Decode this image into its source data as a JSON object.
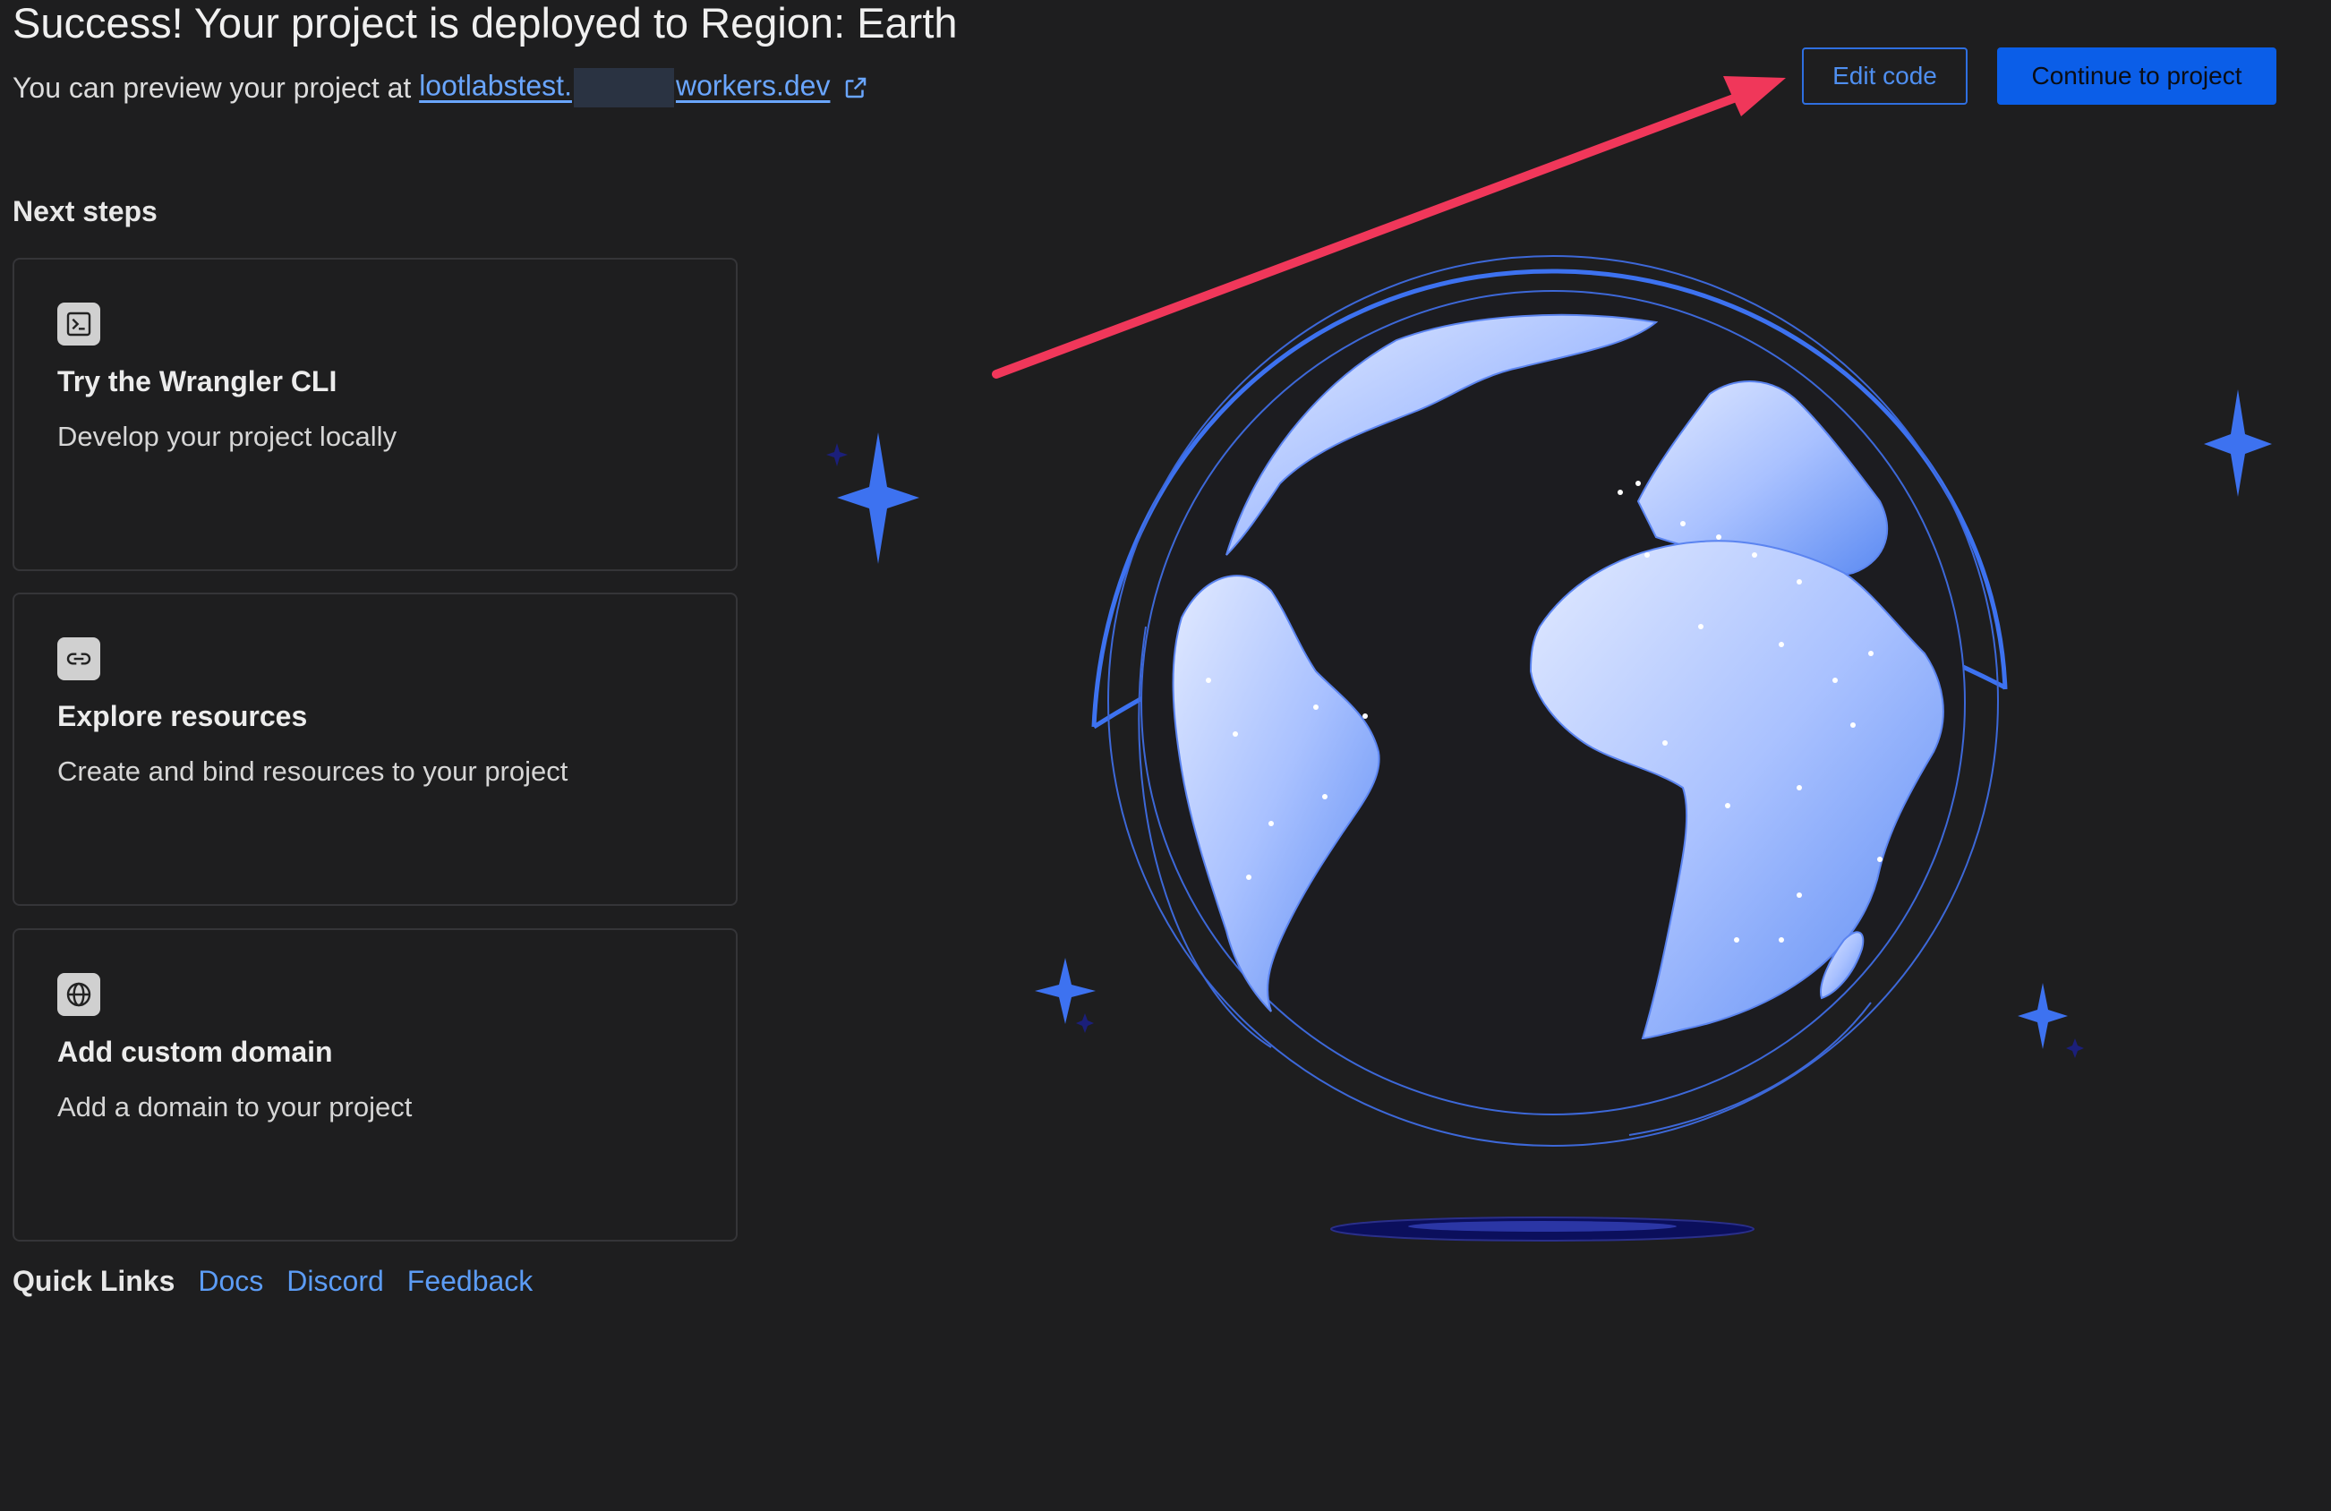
{
  "header": {
    "title": "Success! Your project is deployed to Region: Earth",
    "preview_prefix": "You can preview your project at",
    "url_start": "lootlabstest.",
    "url_end": "workers.dev"
  },
  "actions": {
    "edit_label": "Edit code",
    "continue_label": "Continue to project"
  },
  "next_steps": {
    "title": "Next steps",
    "cards": [
      {
        "icon": "terminal-icon",
        "title": "Try the Wrangler CLI",
        "description": "Develop your project locally"
      },
      {
        "icon": "link-icon",
        "title": "Explore resources",
        "description": "Create and bind resources to your project"
      },
      {
        "icon": "globe-icon",
        "title": "Add custom domain",
        "description": "Add a domain to your project"
      }
    ]
  },
  "quick_links": {
    "label": "Quick Links",
    "links": [
      "Docs",
      "Discord",
      "Feedback"
    ]
  },
  "colors": {
    "background": "#1e1e1f",
    "accent_blue": "#0b5ee8",
    "link_blue": "#5c9cf5",
    "arrow_red": "#f0375a",
    "globe_light": "#c9d8ff",
    "globe_dark": "#5d8ef5"
  }
}
